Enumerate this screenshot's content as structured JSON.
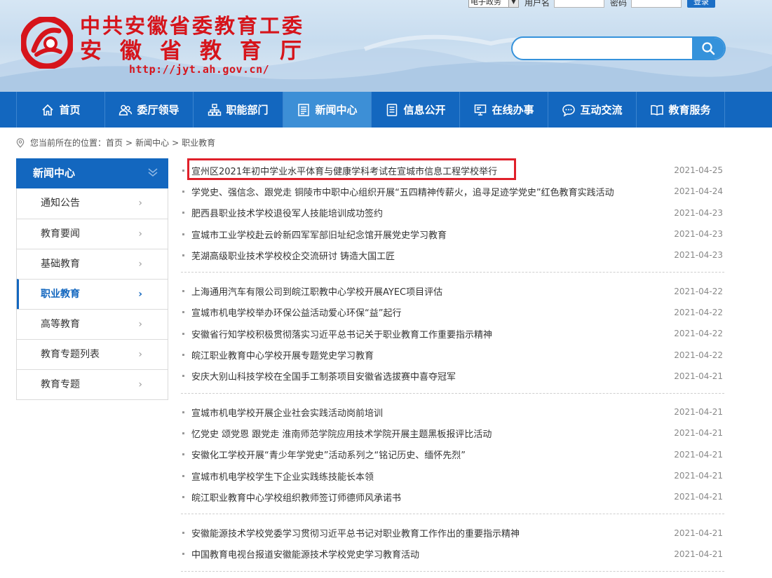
{
  "header": {
    "title_line1": "中共安徽省委教育工委",
    "title_line2": "安徽省教育厅",
    "url": "http://jyt.ah.gov.cn/",
    "login": {
      "select_value": "电子政务",
      "username_label": "用户名",
      "password_label": "密码",
      "login_button": "登录"
    },
    "search_placeholder": ""
  },
  "nav": [
    {
      "label": "首页",
      "icon": "home-icon"
    },
    {
      "label": "委厅领导",
      "icon": "leaders-icon"
    },
    {
      "label": "职能部门",
      "icon": "org-chart-icon"
    },
    {
      "label": "新闻中心",
      "icon": "news-icon",
      "active": true
    },
    {
      "label": "信息公开",
      "icon": "document-icon"
    },
    {
      "label": "在线办事",
      "icon": "monitor-icon"
    },
    {
      "label": "互动交流",
      "icon": "chat-icon"
    },
    {
      "label": "教育服务",
      "icon": "book-icon"
    }
  ],
  "breadcrumb": {
    "prefix": "您当前所在的位置：",
    "items": [
      "首页",
      "新闻中心",
      "职业教育"
    ]
  },
  "sidebar": {
    "title": "新闻中心",
    "items": [
      {
        "label": "通知公告"
      },
      {
        "label": "教育要闻"
      },
      {
        "label": "基础教育"
      },
      {
        "label": "职业教育",
        "active": true
      },
      {
        "label": "高等教育"
      },
      {
        "label": "教育专题列表"
      },
      {
        "label": "教育专题"
      }
    ]
  },
  "news_groups": [
    [
      {
        "title": "宣州区2021年初中学业水平体育与健康学科考试在宣城市信息工程学校举行",
        "date": "2021-04-25",
        "highlight": true
      },
      {
        "title": "学党史、强信念、跟党走 铜陵市中职中心组织开展“五四精神传薪火，追寻足迹学党史”红色教育实践活动",
        "date": "2021-04-24"
      },
      {
        "title": "肥西县职业技术学校退役军人技能培训成功签约",
        "date": "2021-04-23"
      },
      {
        "title": "宣城市工业学校赴云岭新四军军部旧址纪念馆开展党史学习教育",
        "date": "2021-04-23"
      },
      {
        "title": "芜湖高级职业技术学校校企交流研讨 铸造大国工匠",
        "date": "2021-04-23"
      }
    ],
    [
      {
        "title": "上海通用汽车有限公司到皖江职教中心学校开展AYEC项目评估",
        "date": "2021-04-22"
      },
      {
        "title": "宣城市机电学校举办环保公益活动爱心环保“益”起行",
        "date": "2021-04-22"
      },
      {
        "title": "安徽省行知学校积极贯彻落实习近平总书记关于职业教育工作重要指示精神",
        "date": "2021-04-22"
      },
      {
        "title": "皖江职业教育中心学校开展专题党史学习教育",
        "date": "2021-04-22"
      },
      {
        "title": "安庆大别山科技学校在全国手工制茶项目安徽省选拔赛中喜夺冠军",
        "date": "2021-04-21"
      }
    ],
    [
      {
        "title": "宣城市机电学校开展企业社会实践活动岗前培训",
        "date": "2021-04-21"
      },
      {
        "title": "忆党史 颂党恩 跟党走 淮南师范学院应用技术学院开展主题黑板报评比活动",
        "date": "2021-04-21"
      },
      {
        "title": "安徽化工学校开展“青少年学党史”活动系列之“铭记历史、缅怀先烈”",
        "date": "2021-04-21"
      },
      {
        "title": "宣城市机电学校学生下企业实践练技能长本领",
        "date": "2021-04-21"
      },
      {
        "title": "皖江职业教育中心学校组织教师签订师德师风承诺书",
        "date": "2021-04-21"
      }
    ],
    [
      {
        "title": "安徽能源技术学校党委学习贯彻习近平总书记对职业教育工作作出的重要指示精神",
        "date": "2021-04-21"
      },
      {
        "title": "中国教育电视台报道安徽能源技术学校党史学习教育活动",
        "date": "2021-04-21"
      }
    ]
  ],
  "colors": {
    "primary_blue": "#1367bf",
    "active_nav": "#3d8fd6",
    "brand_red": "#d6141b",
    "highlight_box": "#e0202a"
  }
}
